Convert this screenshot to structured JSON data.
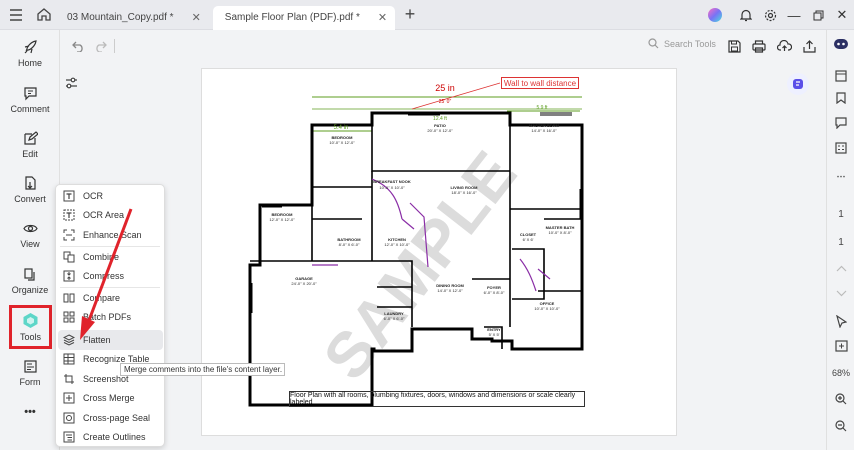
{
  "titlebar": {
    "tabs": [
      {
        "label": "03 Mountain_Copy.pdf *"
      },
      {
        "label": "Sample Floor Plan (PDF).pdf *"
      }
    ]
  },
  "toolbar": {
    "search_placeholder": "Search Tools"
  },
  "sidebar": {
    "items": [
      {
        "label": "Home"
      },
      {
        "label": "Comment"
      },
      {
        "label": "Edit"
      },
      {
        "label": "Convert"
      },
      {
        "label": "View"
      },
      {
        "label": "Organize"
      },
      {
        "label": "Tools"
      },
      {
        "label": "Form"
      }
    ],
    "more": "•••"
  },
  "tools_menu": {
    "items": [
      {
        "label": "OCR",
        "icon": "ocr-icon"
      },
      {
        "label": "OCR Area",
        "icon": "ocr-area-icon"
      },
      {
        "label": "Enhance Scan",
        "icon": "enhance-scan-icon"
      },
      {
        "label": "Combine",
        "icon": "combine-icon"
      },
      {
        "label": "Compress",
        "icon": "compress-icon"
      },
      {
        "label": "Compare",
        "icon": "compare-icon"
      },
      {
        "label": "Batch PDFs",
        "icon": "batch-pdfs-icon"
      },
      {
        "label": "Flatten",
        "icon": "flatten-icon"
      },
      {
        "label": "Recognize Table",
        "icon": "recognize-table-icon"
      },
      {
        "label": "Screenshot",
        "icon": "screenshot-icon"
      },
      {
        "label": "Cross Merge",
        "icon": "cross-merge-icon"
      },
      {
        "label": "Cross-page Seal",
        "icon": "cross-page-seal-icon"
      },
      {
        "label": "Create Outlines",
        "icon": "create-outlines-icon"
      }
    ],
    "tooltip": "Merge comments into the file's content layer."
  },
  "document": {
    "callout": "Wall to wall distance",
    "dim_top": "25 in",
    "dim_top_small": "25' 0\"",
    "dim_mid": "12.4 ft",
    "dim_left": "5.4 in",
    "dim_right": "5.9 ft",
    "watermark": "SAMPLE",
    "caption": "Floor Plan with all rooms, plumbing fixtures, doors, windows and dimensions or scale clearly labeled",
    "rooms": {
      "patio": "PATIO",
      "patio_dim": "20'-0\" X 12'-0\"",
      "master_bdrm": "MASTER BDRM",
      "master_bdrm_dim": "14'-0\" X 16'-0\"",
      "bedroom1": "BEDROOM",
      "bedroom1_dim": "10'-0\" X 12'-0\"",
      "breakfast": "BREAKFAST NOOK",
      "breakfast_dim": "10'-0\" X 10'-0\"",
      "living": "LIVING ROOM",
      "living_dim": "18'-0\" X 16'-0\"",
      "bedroom2": "BEDROOM",
      "bedroom2_dim": "12'-0\" X 12'-0\"",
      "bathroom": "BATHROOM",
      "bathroom_dim": "8'-0\" X 6'-0\"",
      "kitchen": "KITCHEN",
      "kitchen_dim": "12'-0\" X 10'-0\"",
      "closet": "CLOSET",
      "closet_dim": "6' X 6'",
      "master_bath": "MASTER BATH",
      "master_bath_dim": "10'-0\" X 8'-0\"",
      "garage": "GARAGE",
      "garage_dim": "24'-0\" X 20'-0\"",
      "dining": "DINING ROOM",
      "dining_dim": "14'-0\" X 12'-0\"",
      "foyer": "FOYER",
      "foyer_dim": "6'-0\" X 8'-0\"",
      "office": "OFFICE",
      "office_dim": "10'-0\" X 10'-0\"",
      "laundry": "LAUNDRY",
      "laundry_dim": "6'-0\" X 6'-0\"",
      "entry": "ENTRY",
      "entry_dim": "5' X 5'"
    }
  },
  "right_panel": {
    "page_number": "1",
    "total_pages": "1",
    "zoom": "68%"
  },
  "colors": {
    "accent": "#e0232b",
    "dimension": "#d33",
    "dim_green": "#5c9e1f",
    "purple_wall": "#8a2ea6"
  }
}
